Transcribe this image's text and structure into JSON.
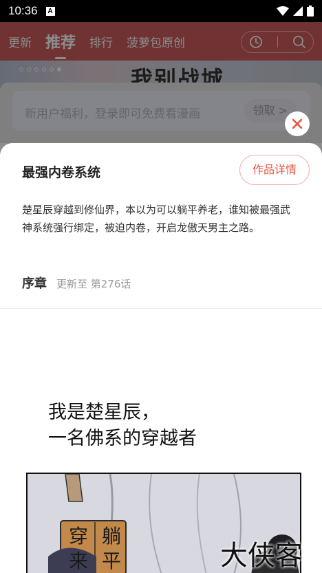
{
  "status_bar": {
    "time": "10:36",
    "notification_badge": "A"
  },
  "background": {
    "nav_tabs": [
      "更新",
      "推荐",
      "排行",
      "菠萝包原创"
    ],
    "active_tab": "推荐",
    "banner_text": "我别战城",
    "promo_text": "新用户福利，登录即可免费看漫画",
    "promo_button": "领取 >"
  },
  "sheet": {
    "title": "最强内卷系统",
    "detail_button": "作品详情",
    "description": "楚星辰穿越到修仙界，本以为可以躺平养老，谁知被最强武神系统强行绑定，被迫内卷，开启龙傲天男主之路。",
    "chapter_label": "序章",
    "update_text": "更新至 第276话"
  },
  "comic": {
    "line1": "我是楚星辰，",
    "line2": "一名佛系的穿越者",
    "sign_chars": [
      "穿",
      "躺",
      "来",
      "平"
    ],
    "watermark": "大侠客"
  },
  "colors": {
    "accent": "#e8503f",
    "nav_bg": "#cc5c5c"
  }
}
